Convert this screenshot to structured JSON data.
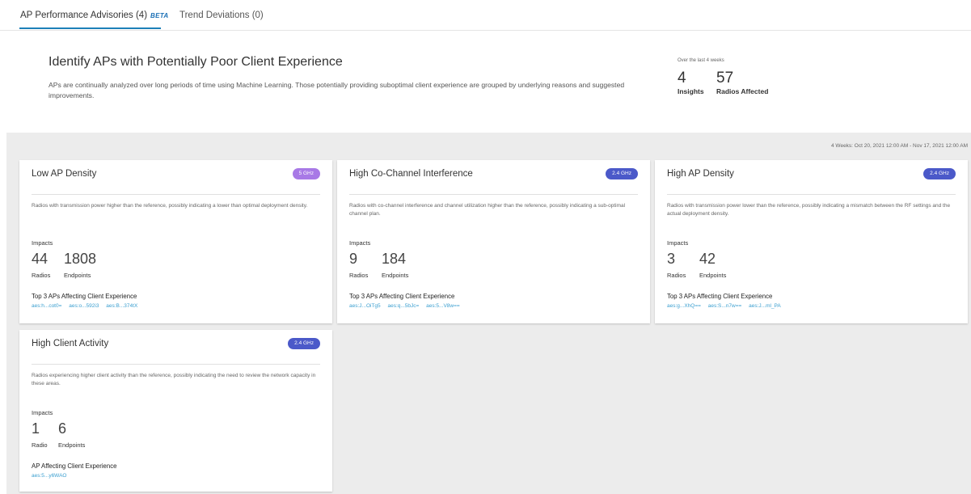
{
  "tabs": [
    {
      "label": "AP Performance Advisories (4)",
      "badge": "BETA"
    },
    {
      "label": "Trend Deviations (0)"
    }
  ],
  "hero": {
    "title": "Identify APs with Potentially Poor Client Experience",
    "description": "APs are continually analyzed over long periods of time using Machine Learning. Those potentially providing suboptimal client experience are grouped by underlying reasons and suggested improvements."
  },
  "stats": {
    "period": "Over the last 4 weeks",
    "insights_value": "4",
    "insights_label": "Insights",
    "radios_value": "57",
    "radios_label": "Radios Affected"
  },
  "date_range": "4 Weeks: Oct 20, 2021 12:00 AM - Nov 17, 2021 12:00 AM",
  "colors": {
    "accent": "#1d80b8",
    "badge_5ghz": "#a879e6",
    "badge_24ghz": "#4b59c9",
    "link": "#3b9fd0"
  },
  "cards": [
    {
      "title": "Low AP Density",
      "band": "5 GHz",
      "description": "Radios with transmission power higher than the reference, possibly indicating a lower than optimal deployment density.",
      "impacts_label": "Impacts",
      "radios": "44",
      "radios_label": "Radios",
      "endpoints": "1808",
      "endpoints_label": "Endpoints",
      "top_title": "Top 3 APs Affecting Client Experience",
      "aps": [
        "aes:h...cot0=",
        "aes:o...592i3",
        "aes:B...374tX"
      ]
    },
    {
      "title": "High Co-Channel Interference",
      "band": "2.4 GHz",
      "description": "Radios with co-channel interference and channel utilization higher than the reference, possibly indicating a sub-optimal channel plan.",
      "impacts_label": "Impacts",
      "radios": "9",
      "radios_label": "Radios",
      "endpoints": "184",
      "endpoints_label": "Endpoints",
      "top_title": "Top 3 APs Affecting Client Experience",
      "aps": [
        "aes:J...OiTg5",
        "aes:q...5bJc=",
        "aes:5...V8w=="
      ]
    },
    {
      "title": "High AP Density",
      "band": "2.4 GHz",
      "description": "Radios with transmission power lower than the reference, possibly indicating a mismatch between the RF settings and the actual deployment density.",
      "impacts_label": "Impacts",
      "radios": "3",
      "radios_label": "Radios",
      "endpoints": "42",
      "endpoints_label": "Endpoints",
      "top_title": "Top 3 APs Affecting Client Experience",
      "aps": [
        "aes:g...XhQ==",
        "aes:S...n7w==",
        "aes:J...ml_PA"
      ]
    },
    {
      "title": "High Client Activity",
      "band": "2.4 GHz",
      "description": "Radios experiencing higher client activity than the reference, possibly indicating the need to review the network capacity in these areas.",
      "impacts_label": "Impacts",
      "radios": "1",
      "radios_label": "Radio",
      "endpoints": "6",
      "endpoints_label": "Endpoints",
      "top_title": "AP Affecting Client Experience",
      "aps": [
        "aes:5...y6WAO"
      ]
    }
  ]
}
